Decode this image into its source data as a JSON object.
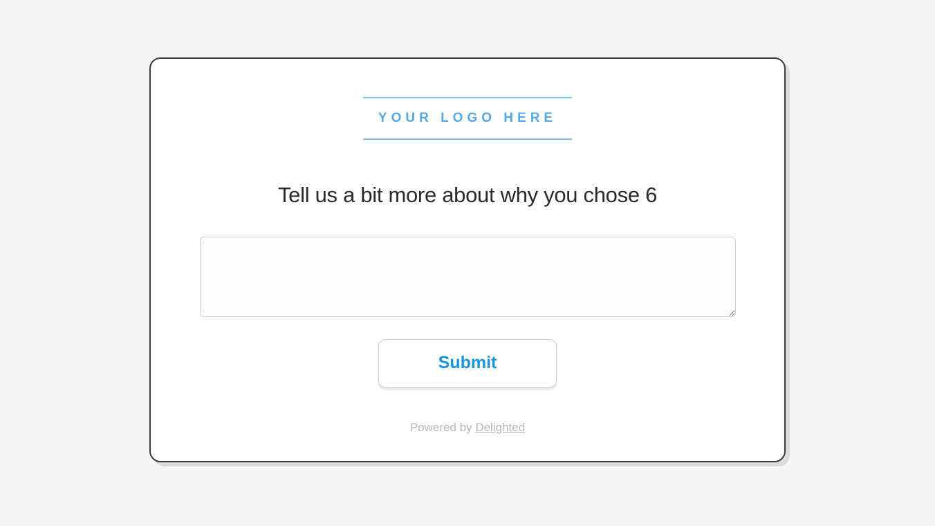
{
  "logo": {
    "placeholder_text": "YOUR LOGO HERE"
  },
  "survey": {
    "prompt": "Tell us a bit more about why you chose 6",
    "textarea_value": "",
    "textarea_placeholder": ""
  },
  "actions": {
    "submit_label": "Submit"
  },
  "footer": {
    "powered_by_prefix": "Powered by ",
    "powered_by_name": "Delighted"
  },
  "colors": {
    "accent": "#1b95e0",
    "logo_border": "#7fbef0",
    "logo_text": "#55a8e8",
    "card_border": "#3a3a3a",
    "background": "#f5f5f5",
    "muted_text": "#b7b7b7"
  }
}
